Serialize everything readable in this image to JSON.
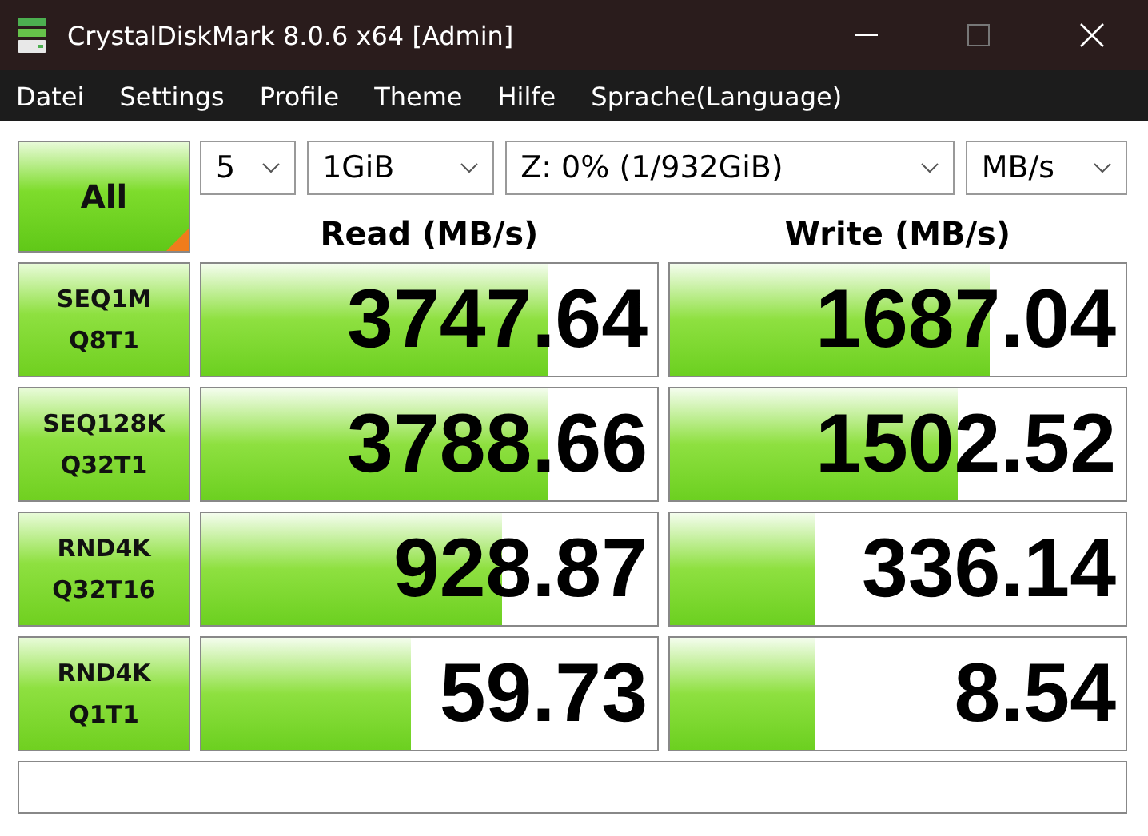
{
  "window": {
    "title": "CrystalDiskMark 8.0.6 x64 [Admin]"
  },
  "menu": [
    "Datei",
    "Settings",
    "Profile",
    "Theme",
    "Hilfe",
    "Sprache(Language)"
  ],
  "all_button": {
    "label": "All"
  },
  "selects": [
    {
      "value": "5"
    },
    {
      "value": "1GiB"
    },
    {
      "value": "Z: 0% (1/932GiB)"
    },
    {
      "value": "MB/s"
    }
  ],
  "columns": [
    "Read (MB/s)",
    "Write (MB/s)"
  ],
  "rows": [
    {
      "test": [
        "SEQ1M",
        "Q8T1"
      ],
      "read": {
        "value": "3747.64",
        "level": 0.76
      },
      "write": {
        "value": "1687.04",
        "level": 0.7
      }
    },
    {
      "test": [
        "SEQ128K",
        "Q32T1"
      ],
      "read": {
        "value": "3788.66",
        "level": 0.76
      },
      "write": {
        "value": "1502.52",
        "level": 0.63
      }
    },
    {
      "test": [
        "RND4K",
        "Q32T16"
      ],
      "read": {
        "value": "928.87",
        "level": 0.66
      },
      "write": {
        "value": "336.14",
        "level": 0.32
      }
    },
    {
      "test": [
        "RND4K",
        "Q1T1"
      ],
      "read": {
        "value": "59.73",
        "level": 0.46
      },
      "write": {
        "value": "8.54",
        "level": 0.32
      }
    }
  ]
}
